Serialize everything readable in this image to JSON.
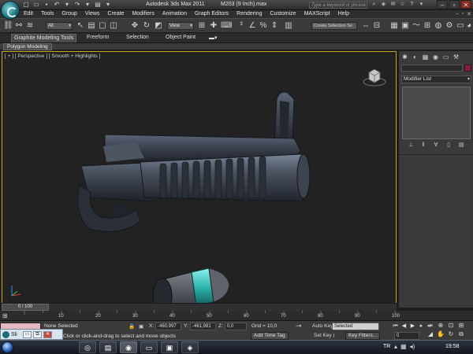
{
  "title": {
    "app": "Autodesk 3ds Max  2011",
    "file": "M203 (9 Inch).max",
    "search_placeholder": "Type a keyword or phrase"
  },
  "menu": [
    "Edit",
    "Tools",
    "Group",
    "Views",
    "Create",
    "Modifiers",
    "Animation",
    "Graph Editors",
    "Rendering",
    "Customize",
    "MAXScript",
    "Help"
  ],
  "toolbar": {
    "selection_filter": "All",
    "ref_coord": "View",
    "selection_set": "Create Selection Se"
  },
  "ribbon": {
    "tabs": [
      "Graphite Modeling Tools",
      "Freeform",
      "Selection",
      "Object Paint"
    ],
    "active_tab": "Graphite Modeling Tools",
    "panel_label": "Polygon Modeling"
  },
  "viewport": {
    "label": "[ + ] [ Perspective ] [ Smooth + Highlights ]"
  },
  "command_panel": {
    "modifier_list": "Modifier List",
    "name_color": "#8d1a3e"
  },
  "timeline": {
    "frame_readout": "0 / 100",
    "ticks": [
      "10",
      "20",
      "30",
      "40",
      "50",
      "60",
      "70",
      "80",
      "90",
      "100"
    ]
  },
  "status": {
    "selection": "None Selected",
    "prompt": "Click or click-and-drag to select and move objects",
    "x_value": "-460,997",
    "y_value": "-461,981",
    "z_value": "0,0",
    "grid": "Grid = 10,0",
    "auto_key": "Auto Key",
    "set_key": "Set Key",
    "key_mode": "Selected",
    "key_filters": "Key Filters...",
    "add_time_tag": "Add Time Tag",
    "current_frame": "0"
  },
  "taskbar": {
    "lang": "TR",
    "clock": "19:58",
    "popup_label": "Sli"
  }
}
